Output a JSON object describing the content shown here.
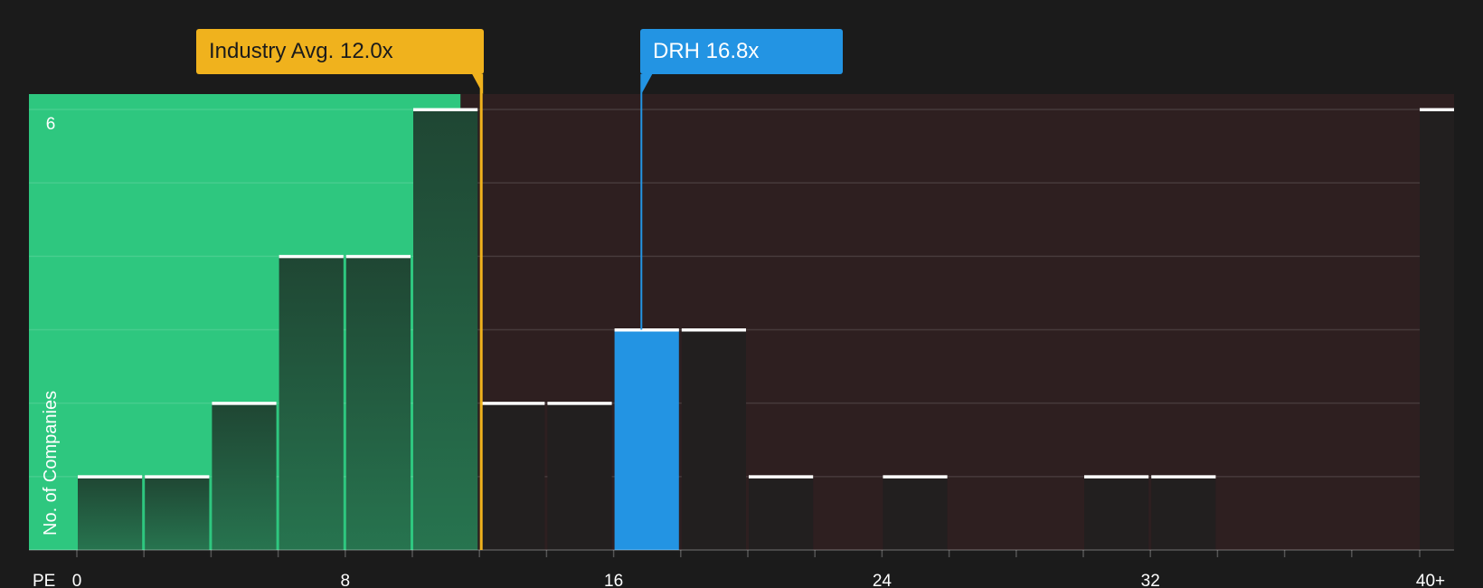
{
  "colors": {
    "background": "#1b1b1b",
    "below_avg_zone": "#2ec77f",
    "above_avg_zone": "#2e1f20",
    "industry_accent": "#f0b21d",
    "company_accent": "#2394e3",
    "bar_dark": "#221f1f",
    "bar_top_marker": "#ffffff"
  },
  "callouts": {
    "industry_label": "Industry Avg. 12.0x",
    "company_label": "DRH 16.8x"
  },
  "chart_data": {
    "type": "bar",
    "xlabel": "PE",
    "ylabel": "No. of Companies",
    "x_ticks": [
      "0",
      "8",
      "16",
      "24",
      "32",
      "40+"
    ],
    "y_ticks": [
      "6"
    ],
    "ylim": [
      0,
      6
    ],
    "bin_width": 2,
    "bins": [
      {
        "start": 0,
        "count": 1
      },
      {
        "start": 2,
        "count": 1
      },
      {
        "start": 4,
        "count": 2
      },
      {
        "start": 6,
        "count": 4
      },
      {
        "start": 8,
        "count": 4
      },
      {
        "start": 10,
        "count": 6
      },
      {
        "start": 12,
        "count": 2
      },
      {
        "start": 14,
        "count": 2
      },
      {
        "start": 16,
        "count": 3,
        "highlight": true
      },
      {
        "start": 18,
        "count": 3
      },
      {
        "start": 20,
        "count": 1
      },
      {
        "start": 24,
        "count": 1
      },
      {
        "start": 30,
        "count": 1
      },
      {
        "start": 32,
        "count": 1
      },
      {
        "start": 40,
        "count": 6,
        "overflow": true
      }
    ],
    "industry_avg": 12.0,
    "company_value": 16.8,
    "company_ticker": "DRH"
  }
}
